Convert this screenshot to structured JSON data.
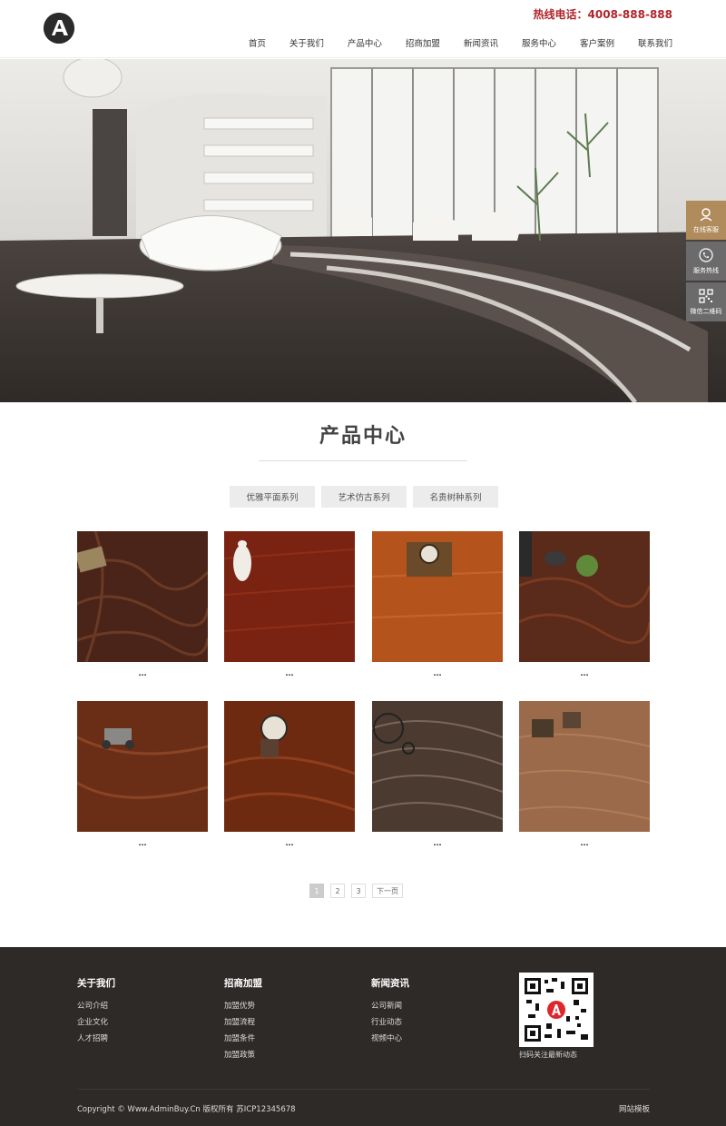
{
  "header": {
    "hotline": "热线电话：4008-888-888",
    "nav": [
      "首页",
      "关于我们",
      "产品中心",
      "招商加盟",
      "新闻资讯",
      "服务中心",
      "客户案例",
      "联系我们"
    ]
  },
  "side_tools": {
    "items": [
      {
        "label": "在线客服",
        "icon": "customer-service-icon"
      },
      {
        "label": "服务热线",
        "icon": "phone-icon"
      },
      {
        "label": "微信二维码",
        "icon": "qrcode-icon"
      }
    ]
  },
  "products": {
    "title": "产品中心",
    "tabs": [
      "优雅平面系列",
      "艺术仿古系列",
      "名贵树种系列"
    ],
    "items": [
      {
        "caption": "..."
      },
      {
        "caption": "..."
      },
      {
        "caption": "..."
      },
      {
        "caption": "..."
      },
      {
        "caption": "..."
      },
      {
        "caption": "..."
      },
      {
        "caption": "..."
      },
      {
        "caption": "..."
      }
    ]
  },
  "pagination": {
    "pages": [
      "1",
      "2",
      "3"
    ],
    "next": "下一页"
  },
  "footer": {
    "columns": [
      {
        "title": "关于我们",
        "links": [
          "公司介绍",
          "企业文化",
          "人才招聘"
        ]
      },
      {
        "title": "招商加盟",
        "links": [
          "加盟优势",
          "加盟流程",
          "加盟条件",
          "加盟政策"
        ]
      },
      {
        "title": "新闻资讯",
        "links": [
          "公司新闻",
          "行业动态",
          "视频中心"
        ]
      }
    ],
    "qr_caption": "扫码关注最新动态",
    "copyright": "Copyright © Www.AdminBuy.Cn 版权所有 苏ICP12345678",
    "sitemap": "网站模板"
  },
  "colors": {
    "accent": "#b0242a",
    "side_active": "#b08b5b",
    "footer_bg": "#2e2a28"
  }
}
